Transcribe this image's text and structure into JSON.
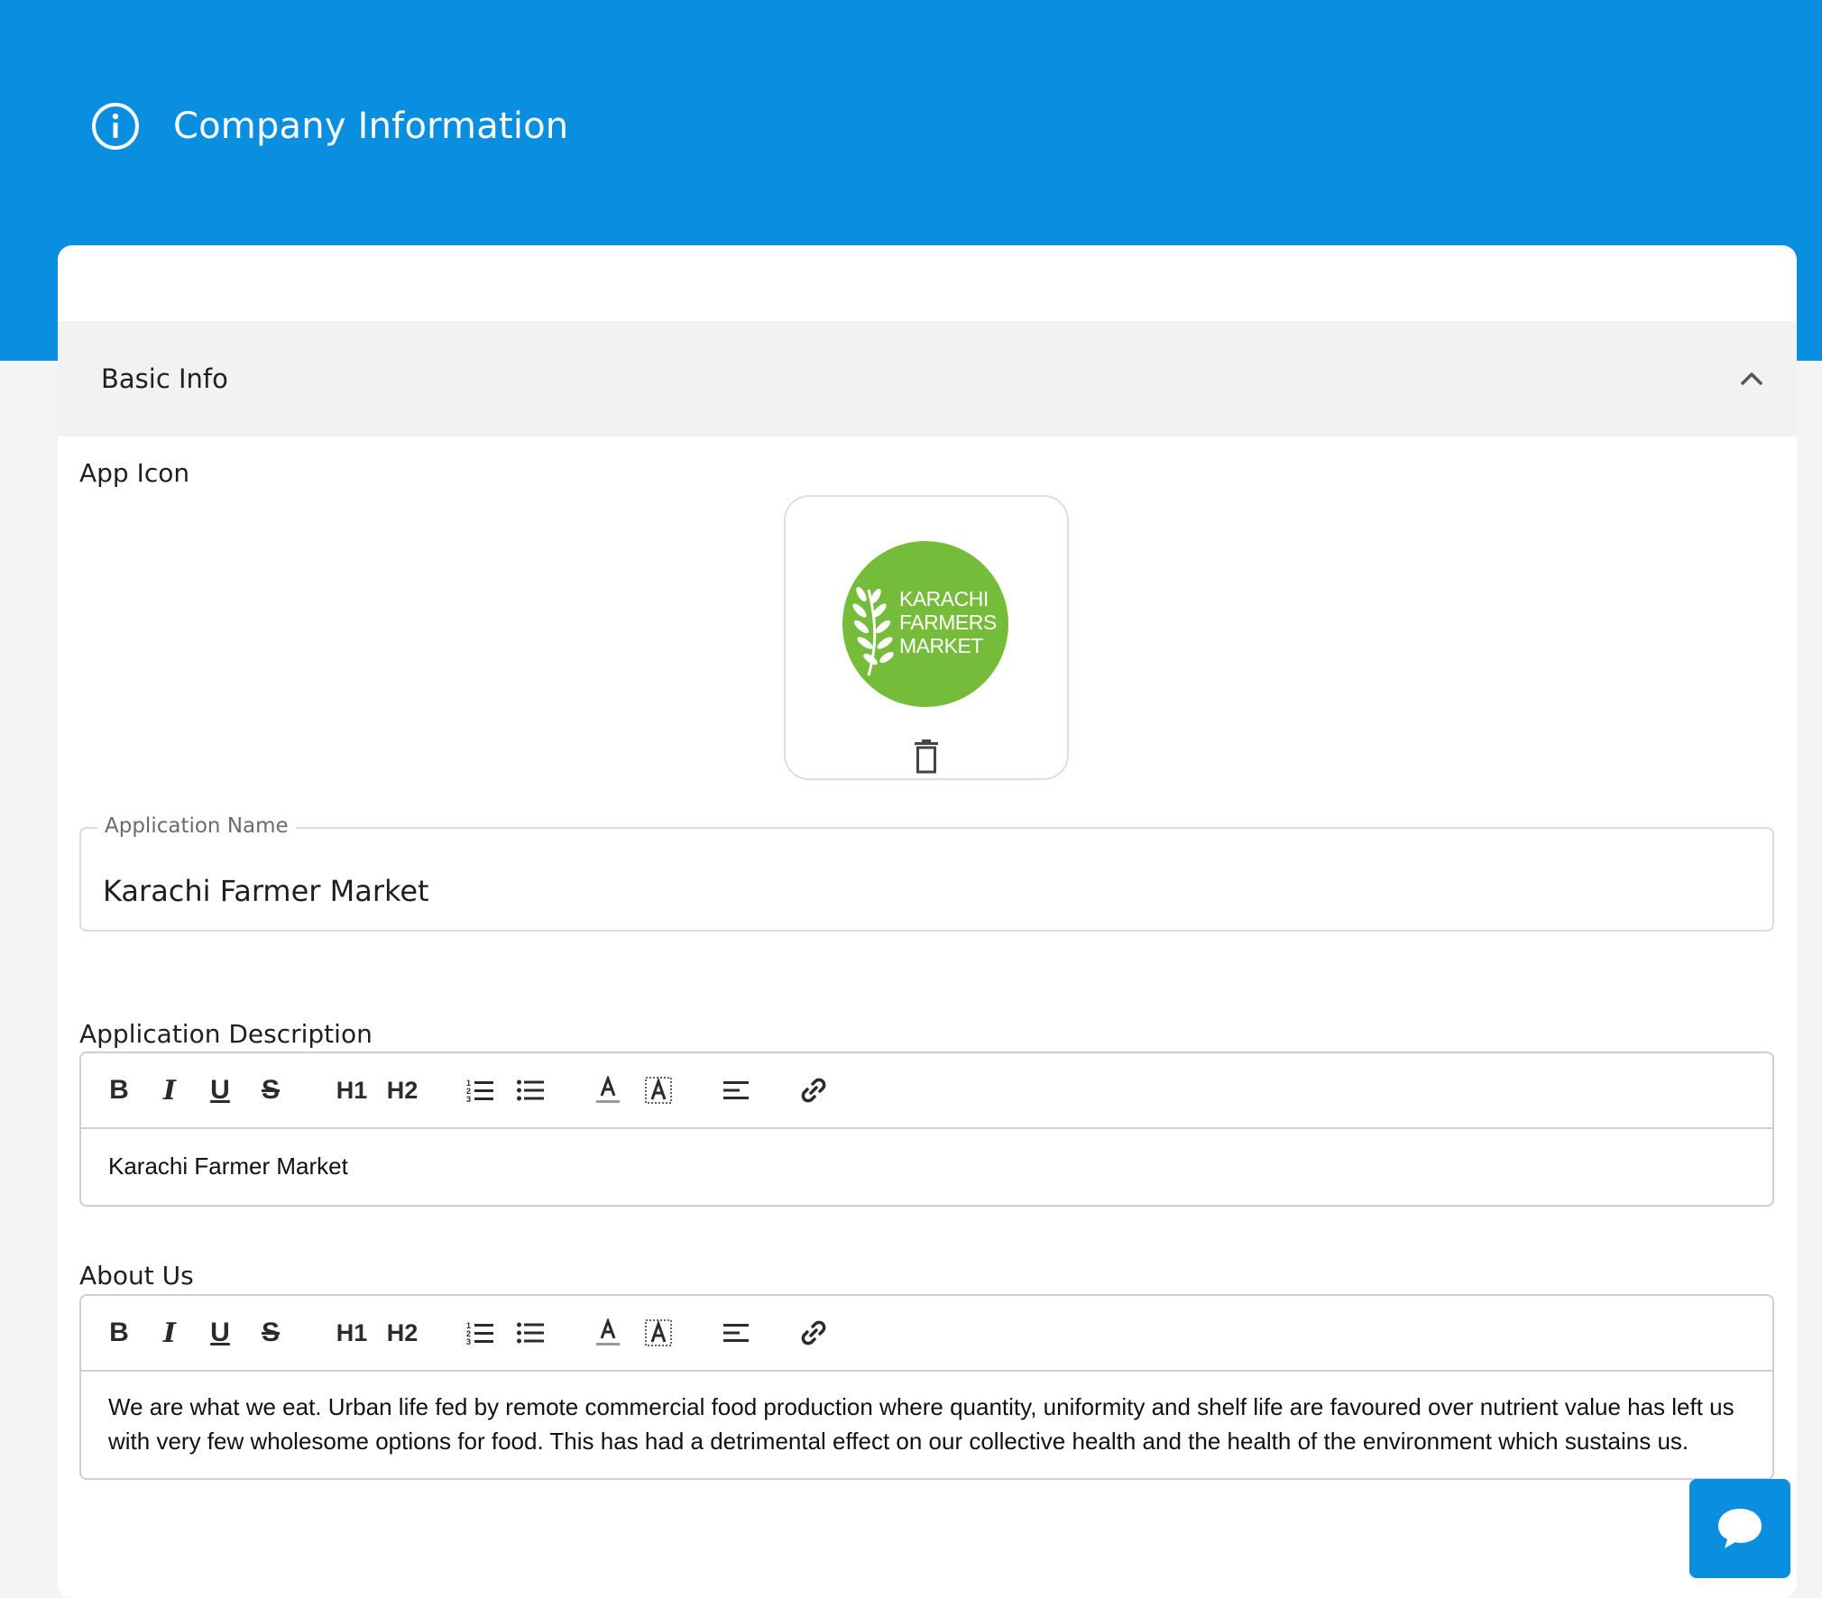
{
  "header": {
    "title": "Company Information",
    "icon": "info-circle-icon",
    "background_color": "#0a8fe0"
  },
  "basic_info": {
    "section_title": "Basic Info",
    "collapse_icon": "chevron-up-icon",
    "app_icon": {
      "label": "App Icon",
      "logo_text": [
        "KARACHI",
        "FARMERS",
        "MARKET"
      ],
      "logo_color": "#76bc3b",
      "delete_icon": "trash-icon"
    },
    "application_name": {
      "label": "Application Name",
      "value": "Karachi Farmer Market"
    },
    "application_description": {
      "label": "Application Description",
      "content": "Karachi Farmer Market"
    },
    "about_us": {
      "label": "About Us",
      "content": "We are what we eat. Urban life fed by remote commercial food production where quantity, uniformity and shelf life are favoured over nutrient value has left us with very few wholesome options for food. This has had a detrimental effect on our collective health and the health of the environment which sustains us."
    }
  },
  "toolbar": {
    "bold": "B",
    "italic": "I",
    "underline": "U",
    "strike": "S",
    "h1": "H1",
    "h2": "H2",
    "buttons": [
      "bold-icon",
      "italic-icon",
      "underline-icon",
      "strikethrough-icon",
      "heading-1-icon",
      "heading-2-icon",
      "ordered-list-icon",
      "bullet-list-icon",
      "font-color-icon",
      "highlight-color-icon",
      "align-left-icon",
      "link-icon"
    ]
  },
  "chat": {
    "icon": "chat-bubble-icon"
  }
}
